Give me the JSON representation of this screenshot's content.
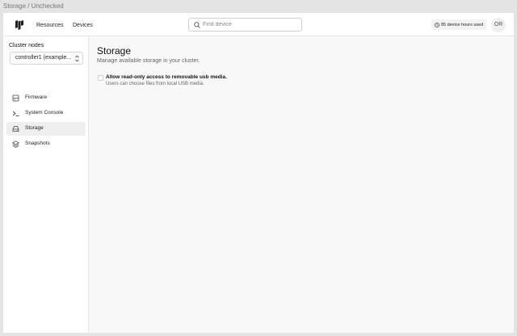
{
  "window": {
    "title": "Storage / Unchecked"
  },
  "header": {
    "nav": [
      {
        "label": "Resources"
      },
      {
        "label": "Devices"
      }
    ],
    "search": {
      "placeholder": "Find device",
      "value": ""
    },
    "usage": "85 device hours used",
    "avatar": "OR"
  },
  "sidebar": {
    "heading": "Cluster nodes",
    "node_select": "controller1 (example...",
    "items": [
      {
        "label": "Firmware",
        "icon": "firmware-icon",
        "active": false
      },
      {
        "label": "System Console",
        "icon": "terminal-icon",
        "active": false
      },
      {
        "label": "Storage",
        "icon": "storage-icon",
        "active": true
      },
      {
        "label": "Snapshots",
        "icon": "layers-icon",
        "active": false
      }
    ]
  },
  "main": {
    "title": "Storage",
    "subtitle": "Manage available storage in your cluster.",
    "option": {
      "label": "Allow read-only access to removable usb media.",
      "help": "Users can choose files from local USB media.",
      "checked": false
    }
  },
  "colors": {
    "background": "#e4e4e4",
    "surface": "#ffffff",
    "main_bg": "#f8f8f8",
    "active_item": "#efefef",
    "border": "#e6e6e6"
  }
}
